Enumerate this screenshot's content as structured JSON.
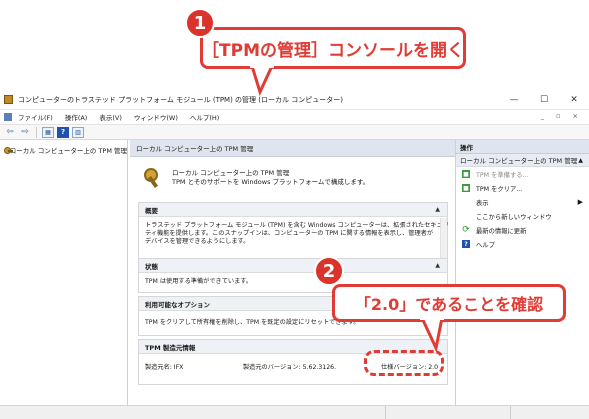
{
  "window": {
    "title": "コンピューターのトラステッド プラットフォーム モジュール (TPM) の管理 (ローカル コンピューター)",
    "controls": [
      "—",
      "☐",
      "✕"
    ]
  },
  "menu": {
    "items": [
      "ファイル(F)",
      "操作(A)",
      "表示(V)",
      "ウィンドウ(W)",
      "ヘルプ(H)"
    ],
    "right_controls": "_ ▫ ×"
  },
  "toolbar": {
    "back": "⇦",
    "forward": "⇨",
    "help": "?"
  },
  "tree": {
    "root_label": "ローカル コンピューター上の TPM 管理"
  },
  "center": {
    "header": "ローカル コンピューター上の TPM 管理",
    "intro_line1": "ローカル コンピューター上の TPM 管理",
    "intro_line2": "TPM とそのサポートを Windows プラットフォームで構成します。",
    "overview": {
      "title": "概要",
      "lines": [
        "トラステッド プラットフォーム モジュール (TPM) を含む Windows コンピューターは、拡張されたセキュリ",
        "ティ機能を提供します。このスナップインは、コンピューターの TPM に関する情報を表示し、管理者が",
        "デバイスを管理できるようにします。"
      ]
    },
    "status": {
      "title": "状態",
      "text": "TPM は使用する準備ができています。"
    },
    "options": {
      "title": "利用可能なオプション",
      "text": "TPM をクリアして所有権を削除し、TPM を既定の設定にリセットできます。"
    },
    "manufacturer": {
      "title": "TPM 製造元情報",
      "name_label": "製造元名: IFX",
      "version_label": "製造元のバージョン: 5.62.3126.",
      "spec_label": "仕様バージョン: 2.0"
    }
  },
  "actions": {
    "header": "操作",
    "subheader": "ローカル コンピューター上の TPM 管理",
    "items": [
      {
        "label": "TPM を準備する...",
        "disabled": true
      },
      {
        "label": "TPM をクリア...",
        "disabled": false
      },
      {
        "label": "表示",
        "disabled": false
      },
      {
        "label": "ここから新しいウィンドウ",
        "disabled": false
      },
      {
        "label": "最新の情報に更新",
        "disabled": false
      },
      {
        "label": "ヘルプ",
        "disabled": false
      }
    ]
  },
  "annotations": {
    "step1_number": "1",
    "step1_text": "［TPMの管理］コンソールを開く",
    "step2_number": "2",
    "step2_text": "「2.0」であることを確認",
    "accent_color": "#e03b34"
  }
}
